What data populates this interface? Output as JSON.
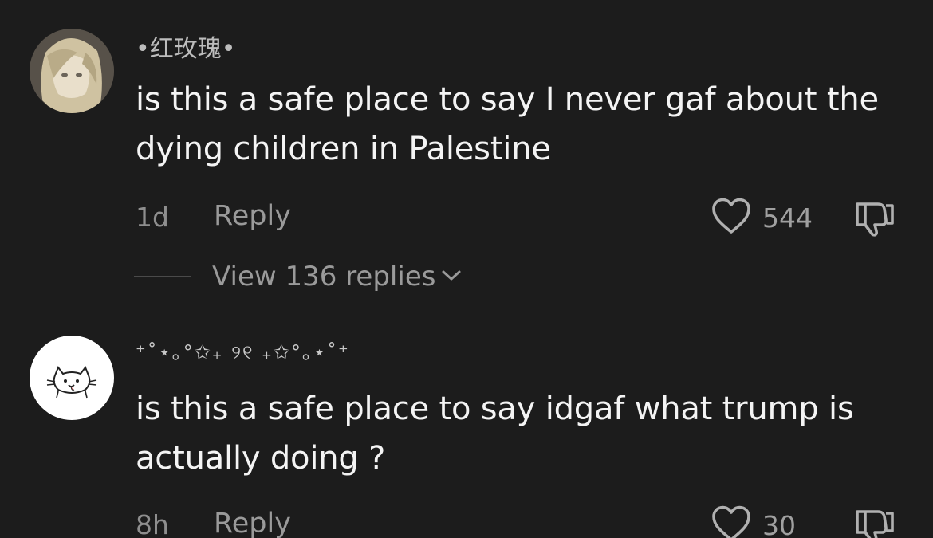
{
  "comments": [
    {
      "username": "•红玫瑰•",
      "avatar_icon": "anime-girl-avatar",
      "text": "is this a safe place to say I never gaf about the dying children in Palestine",
      "time": "1d",
      "reply_label": "Reply",
      "likes": "544",
      "view_replies": "View 136 replies"
    },
    {
      "username": "⁺˚⋆｡°✩₊ ୨୧ ₊✩°｡⋆˚⁺",
      "avatar_icon": "cat-doodle-avatar",
      "text": "is this a safe place to say idgaf what trump is actually doing ?",
      "time": "8h",
      "reply_label": "Reply",
      "likes": "30"
    }
  ],
  "colors": {
    "background": "#1c1c1c",
    "text": "#f4f4f4",
    "muted": "#8e8e8e"
  },
  "icons": [
    "heart-outline-icon",
    "thumbs-down-icon",
    "chevron-down-icon"
  ]
}
